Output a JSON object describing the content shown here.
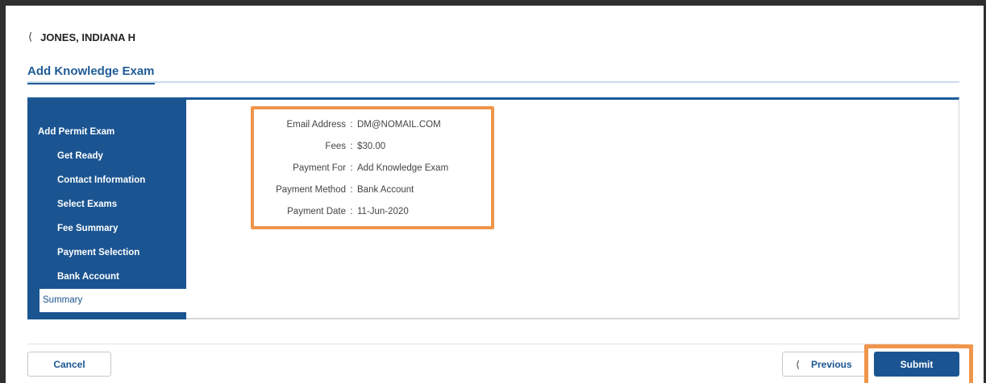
{
  "header": {
    "back_label": "JONES, INDIANA H",
    "page_title": "Add Knowledge Exam"
  },
  "sidebar": {
    "header": "Add Permit Exam",
    "items": [
      {
        "label": "Get Ready",
        "active": false
      },
      {
        "label": "Contact Information",
        "active": false
      },
      {
        "label": "Select Exams",
        "active": false
      },
      {
        "label": "Fee Summary",
        "active": false
      },
      {
        "label": "Payment Selection",
        "active": false
      },
      {
        "label": "Bank Account",
        "active": false
      },
      {
        "label": "Summary",
        "active": true
      }
    ]
  },
  "summary": {
    "separator": ":",
    "rows": [
      {
        "label": "Email Address",
        "value": "DM@NOMAIL.COM"
      },
      {
        "label": "Fees",
        "value": "$30.00"
      },
      {
        "label": "Payment For",
        "value": "Add Knowledge Exam"
      },
      {
        "label": "Payment Method",
        "value": "Bank Account"
      },
      {
        "label": "Payment Date",
        "value": "11-Jun-2020"
      }
    ]
  },
  "footer": {
    "cancel_label": "Cancel",
    "previous_label": "Previous",
    "submit_label": "Submit"
  },
  "icons": {
    "back": "chevron-left-icon",
    "previous": "chevron-left-icon"
  },
  "colors": {
    "primary": "#1b5591",
    "title": "#1f5c99",
    "highlight": "#f0954a"
  }
}
